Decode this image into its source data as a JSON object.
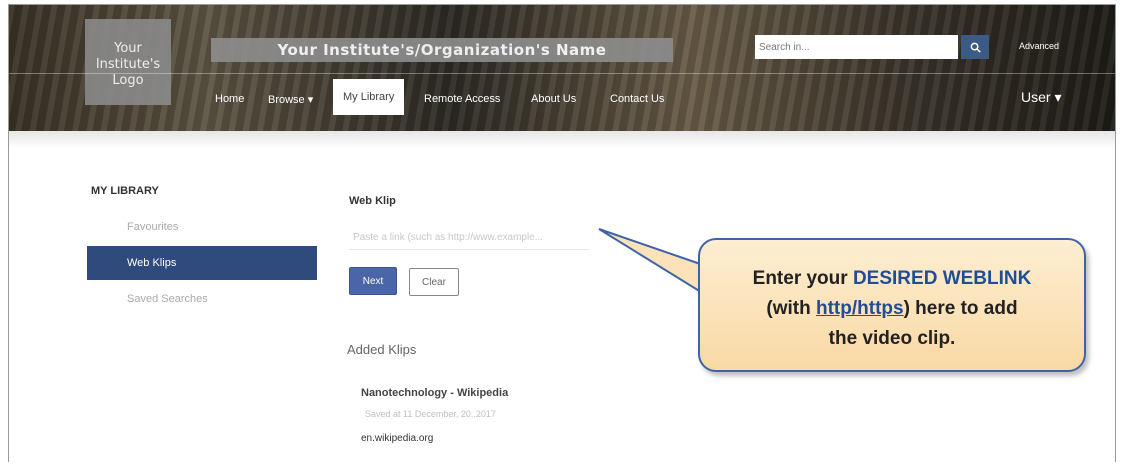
{
  "header": {
    "logo_line1": "Your",
    "logo_line2": "Institute's",
    "logo_line3": "Logo",
    "org_name": "Your Institute's/Organization's Name",
    "search_placeholder": "Search in...",
    "search_icon": "magnifier-icon",
    "advanced_label": "Advanced",
    "nav": {
      "home": "Home",
      "browse": "Browse ▾",
      "my_library": "My Library",
      "remote_access": "Remote Access",
      "about_us": "About Us",
      "contact_us": "Contact Us"
    },
    "user_label": "User ▾"
  },
  "sidebar": {
    "title": "MY LIBRARY",
    "items": [
      "Favourites",
      "Web Klips",
      "Saved Searches"
    ],
    "active_index": 1,
    "active_color": "#2f4a7c"
  },
  "content": {
    "title": "Web Klip",
    "input_placeholder": "Paste a link (such as http://www.example...",
    "next_label": "Next",
    "clear_label": "Clear",
    "added_title": "Added Klips",
    "klips": [
      {
        "name": "Nanotechnology - Wikipedia",
        "date": "Saved at 11 December, 20..2017",
        "url": "en.wikipedia.org"
      }
    ]
  },
  "callout": {
    "line1_prefix": "Enter your ",
    "line1_highlight": "DESIRED WEBLINK",
    "line2_open": "(with ",
    "line2_link": "http/https",
    "line2_close": ") here to add",
    "line3": "the video clip.",
    "fill_color": "#fbe2b8",
    "border_color": "#3d63a8"
  }
}
